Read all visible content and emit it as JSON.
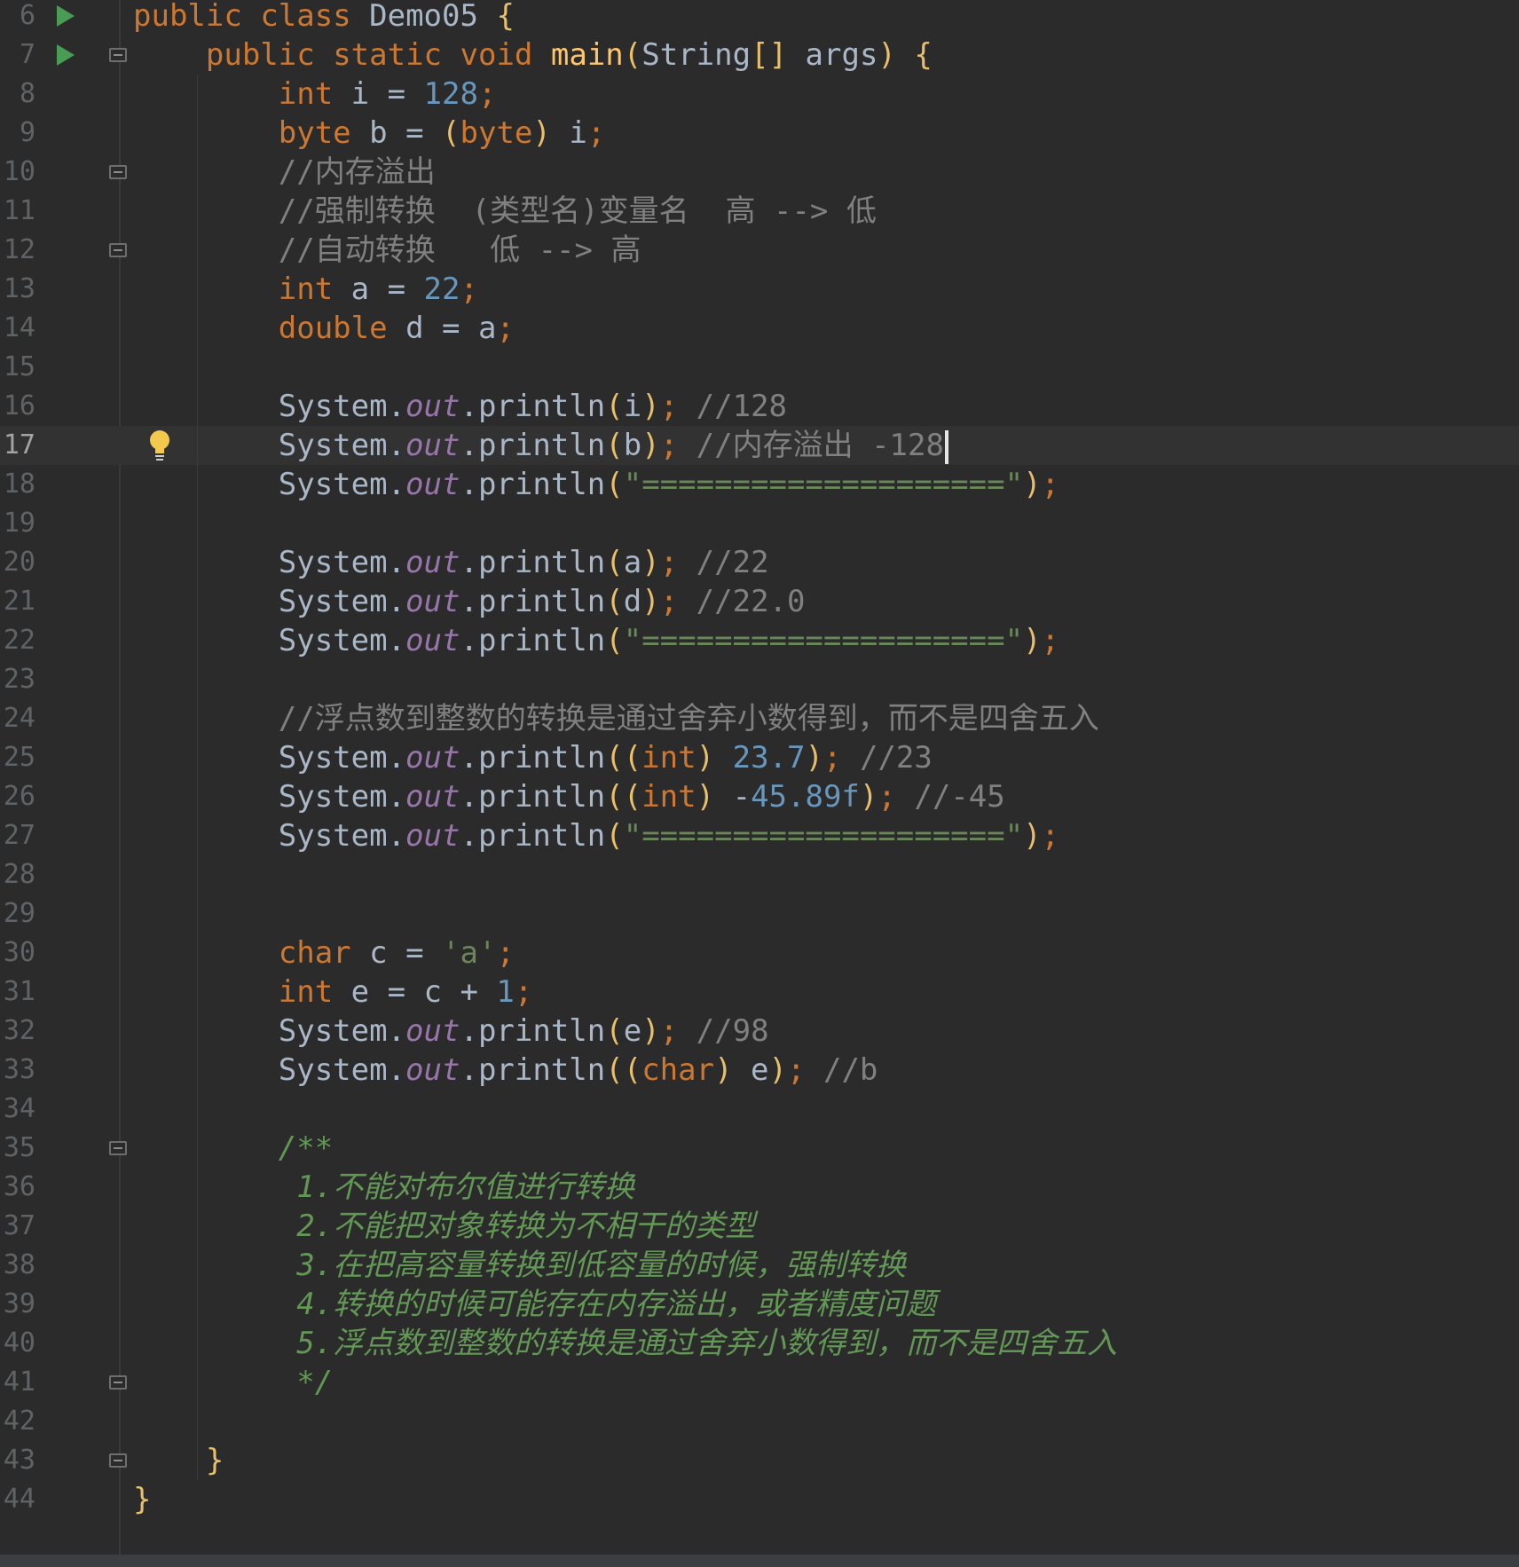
{
  "editor": {
    "current_line": "17",
    "lines": [
      {
        "n": "6",
        "text": "public class Demo05 {"
      },
      {
        "n": "7",
        "text": "    public static void main(String[] args) {"
      },
      {
        "n": "8",
        "text": "        int i = 128;"
      },
      {
        "n": "9",
        "text": "        byte b = (byte) i;"
      },
      {
        "n": "10",
        "text": "        //内存溢出"
      },
      {
        "n": "11",
        "text": "        //强制转换  (类型名)变量名  高 --> 低"
      },
      {
        "n": "12",
        "text": "        //自动转换   低 --> 高"
      },
      {
        "n": "13",
        "text": "        int a = 22;"
      },
      {
        "n": "14",
        "text": "        double d = a;"
      },
      {
        "n": "15",
        "text": ""
      },
      {
        "n": "16",
        "text": "        System.out.println(i); //128"
      },
      {
        "n": "17",
        "text": "        System.out.println(b); //内存溢出 -128"
      },
      {
        "n": "18",
        "text": "        System.out.println(\"====================\");"
      },
      {
        "n": "19",
        "text": ""
      },
      {
        "n": "20",
        "text": "        System.out.println(a); //22"
      },
      {
        "n": "21",
        "text": "        System.out.println(d); //22.0"
      },
      {
        "n": "22",
        "text": "        System.out.println(\"====================\");"
      },
      {
        "n": "23",
        "text": ""
      },
      {
        "n": "24",
        "text": "        //浮点数到整数的转换是通过舍弃小数得到，而不是四舍五入"
      },
      {
        "n": "25",
        "text": "        System.out.println((int) 23.7); //23"
      },
      {
        "n": "26",
        "text": "        System.out.println((int) -45.89f); //-45"
      },
      {
        "n": "27",
        "text": "        System.out.println(\"====================\");"
      },
      {
        "n": "28",
        "text": ""
      },
      {
        "n": "29",
        "text": ""
      },
      {
        "n": "30",
        "text": "        char c = 'a';"
      },
      {
        "n": "31",
        "text": "        int e = c + 1;"
      },
      {
        "n": "32",
        "text": "        System.out.println(e); //98"
      },
      {
        "n": "33",
        "text": "        System.out.println((char) e); //b"
      },
      {
        "n": "34",
        "text": ""
      },
      {
        "n": "35",
        "text": "        /**"
      },
      {
        "n": "36",
        "text": "         1.不能对布尔值进行转换"
      },
      {
        "n": "37",
        "text": "         2.不能把对象转换为不相干的类型"
      },
      {
        "n": "38",
        "text": "         3.在把高容量转换到低容量的时候，强制转换"
      },
      {
        "n": "39",
        "text": "         4.转换的时候可能存在内存溢出，或者精度问题"
      },
      {
        "n": "40",
        "text": "         5.浮点数到整数的转换是通过舍弃小数得到，而不是四舍五入"
      },
      {
        "n": "41",
        "text": "         */"
      },
      {
        "n": "42",
        "text": ""
      },
      {
        "n": "43",
        "text": "    }"
      },
      {
        "n": "44",
        "text": "}"
      }
    ]
  },
  "colors": {
    "background": "#2b2b2b",
    "current_line": "#323232",
    "keyword": "#cc7832",
    "number": "#6897bb",
    "string": "#6a8759",
    "comment": "#808080",
    "doc_comment": "#629755",
    "field": "#9876aa",
    "method": "#ffc66d",
    "plain": "#a9b7c6",
    "run_icon": "#499c54",
    "bulb": "#f2c94c"
  },
  "icons": {
    "run": "run-gutter-icon",
    "fold": "fold-marker-icon",
    "intention": "lightbulb-icon"
  }
}
